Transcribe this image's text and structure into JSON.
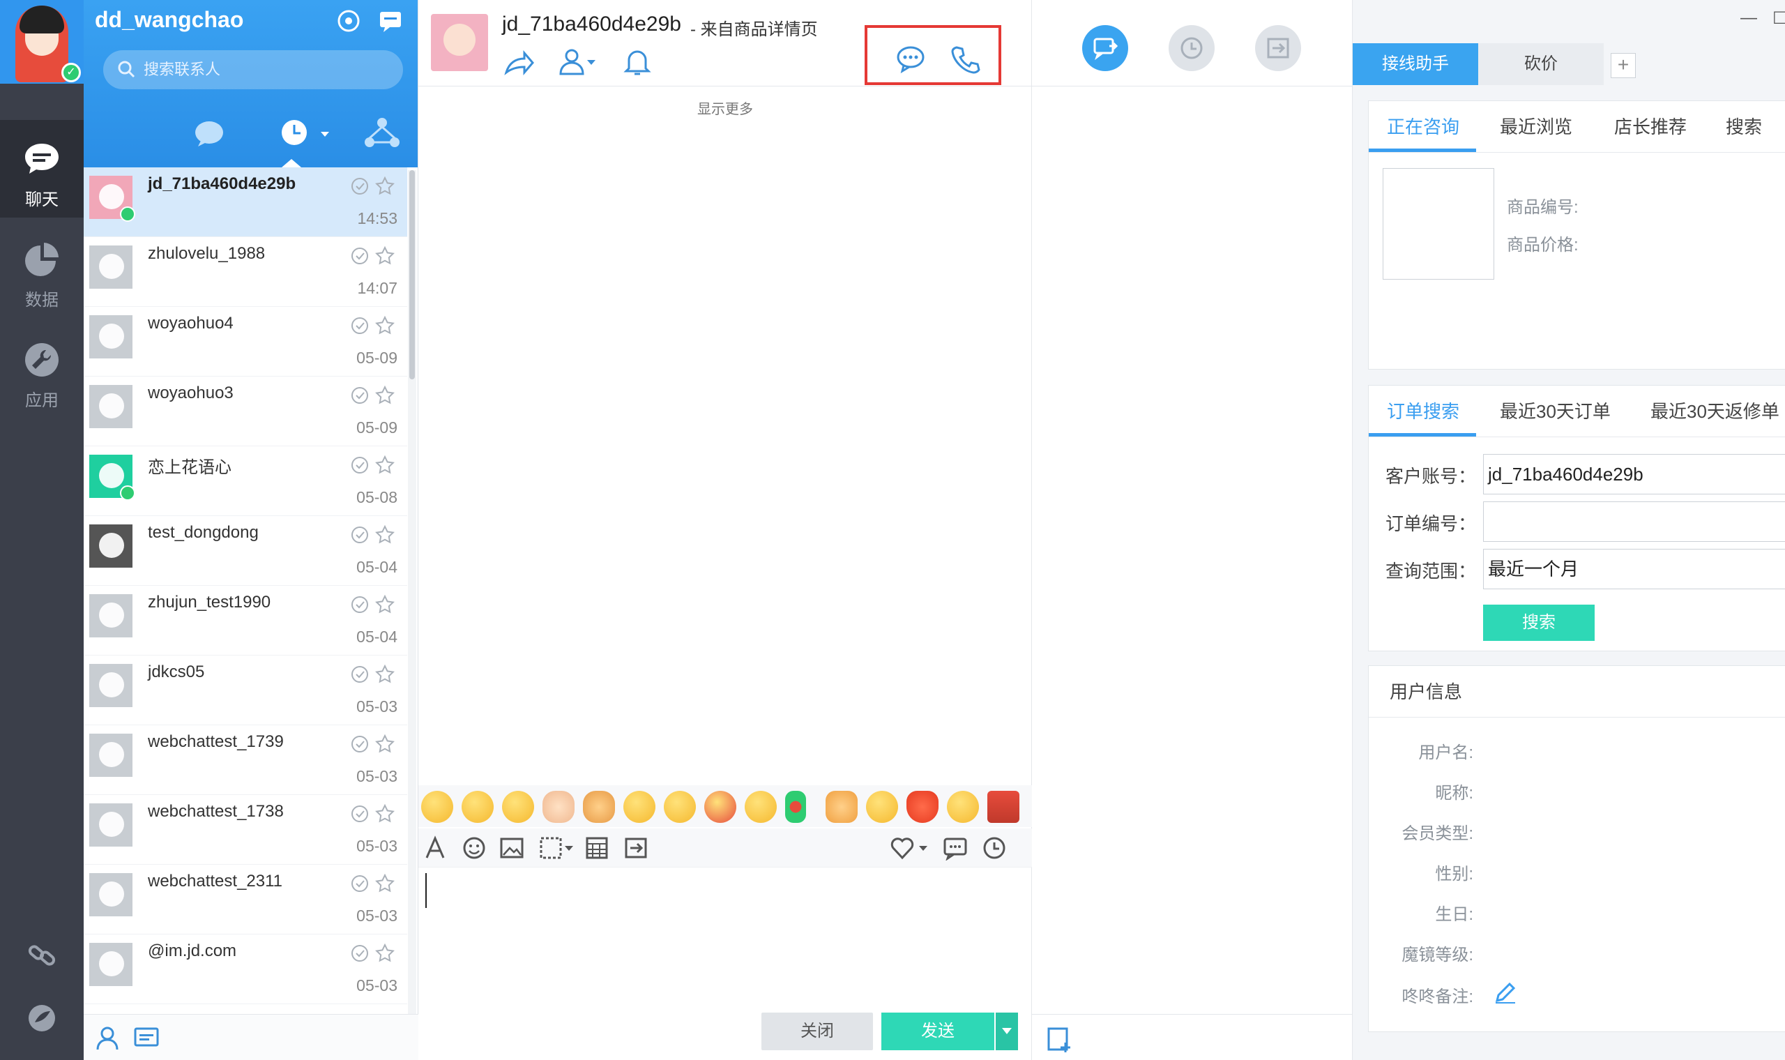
{
  "sidebar": {
    "items": [
      {
        "id": "chat",
        "label": "聊天",
        "icon": "chat-bubble-icon",
        "active": true
      },
      {
        "id": "data",
        "label": "数据",
        "icon": "pie-chart-icon",
        "active": false
      },
      {
        "id": "apps",
        "label": "应用",
        "icon": "wrench-icon",
        "active": false
      }
    ]
  },
  "contacts_panel": {
    "username": "dd_wangchao",
    "search_placeholder": "搜索联系人",
    "contacts": [
      {
        "name": "jd_71ba460d4e29b",
        "time": "14:53",
        "selected": true
      },
      {
        "name": "zhulovelu_1988",
        "time": "14:07"
      },
      {
        "name": "woyaohuo4",
        "time": "05-09"
      },
      {
        "name": "woyaohuo3",
        "time": "05-09"
      },
      {
        "name": "恋上花语心",
        "time": "05-08"
      },
      {
        "name": "test_dongdong",
        "time": "05-04"
      },
      {
        "name": "zhujun_test1990",
        "time": "05-04"
      },
      {
        "name": "jdkcs05",
        "time": "05-03"
      },
      {
        "name": "webchattest_1739",
        "time": "05-03"
      },
      {
        "name": "webchattest_1738",
        "time": "05-03"
      },
      {
        "name": "webchattest_2311",
        "time": "05-03"
      },
      {
        "name": "@im.jd.com",
        "time": "05-03"
      }
    ]
  },
  "chat": {
    "peer_name": "jd_71ba460d4e29b",
    "source": "- 来自商品详情页",
    "show_more": "显示更多",
    "close_label": "关闭",
    "send_label": "发送"
  },
  "assistant": {
    "tab_active": "接线助手",
    "tab_other": "砍价",
    "tab_add": "+",
    "window_min": "—",
    "window_max": "☐",
    "product_tabs": [
      "正在咨询",
      "最近浏览",
      "店长推荐",
      "搜索"
    ],
    "product_no_label": "商品编号:",
    "product_price_label": "商品价格:",
    "order_tabs": [
      "订单搜索",
      "最近30天订单",
      "最近30天返修单"
    ],
    "account_label": "客户账号：",
    "account_value": "jd_71ba460d4e29b",
    "order_no_label": "订单编号：",
    "order_no_value": "",
    "range_label": "查询范围：",
    "range_value": "最近一个月",
    "search_btn": "搜索",
    "user_info_title": "用户信息",
    "user_fields": [
      "用户名:",
      "昵称:",
      "会员类型:",
      "性别:",
      "生日:",
      "魔镜等级:",
      "咚咚备注:"
    ]
  },
  "colors": {
    "brand_blue": "#3aa4f0",
    "send_green": "#2ed8b6",
    "highlight_red": "#e53935",
    "nav_dark": "#3b3f4a"
  }
}
